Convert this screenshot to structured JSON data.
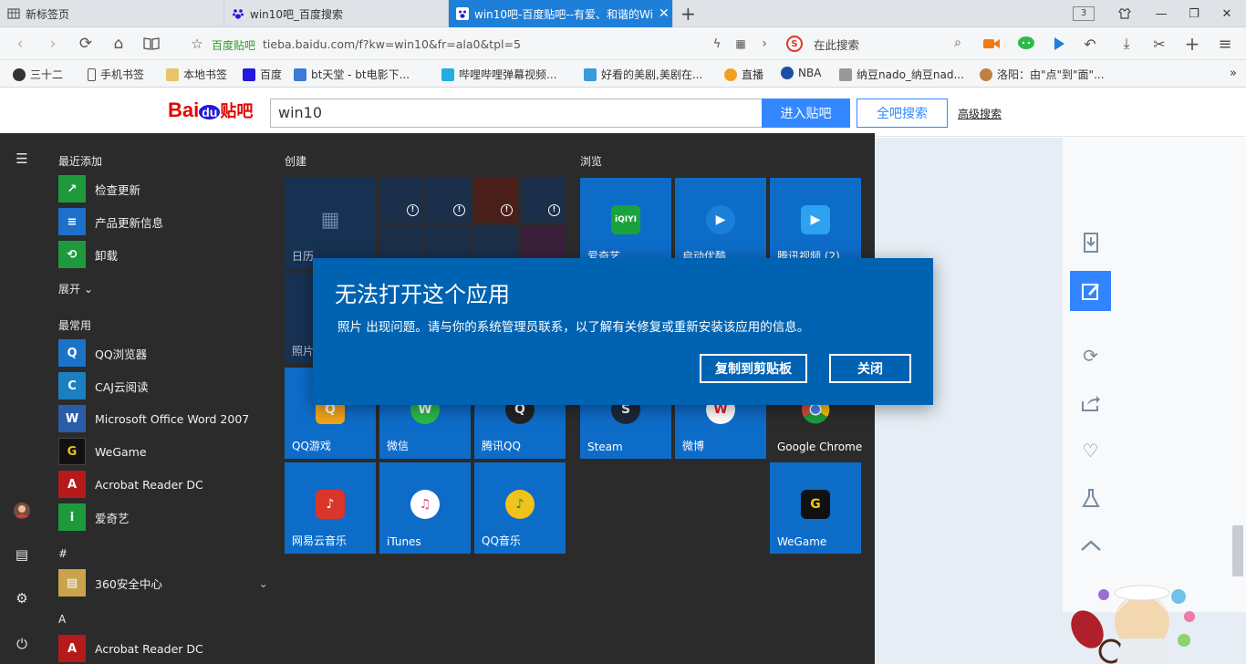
{
  "browser": {
    "tabs": [
      {
        "title": "新标签页",
        "active": false
      },
      {
        "title": "win10吧_百度搜索",
        "active": false
      },
      {
        "title": "win10吧-百度贴吧--有爱、和谐的Wi",
        "active": true
      }
    ],
    "tab_count": "3",
    "address": {
      "site_name": "百度贴吧",
      "url": "tieba.baidu.com/f?kw=win10&fr=ala0&tpl=5"
    },
    "search_placeholder": "在此搜索",
    "bookmarks": [
      "三十二",
      "手机书签",
      "本地书签",
      "百度",
      "bt天堂 - bt电影下...",
      "哔哩哔哩弹幕视频...",
      "好看的美剧,美剧在...",
      "直播",
      "NBA",
      "纳豆nado_纳豆nad...",
      "洛阳：由\"点\"到\"面\"..."
    ]
  },
  "tieba": {
    "logo_bai": "Bai",
    "logo_du": "du",
    "logo_tieba": "贴吧",
    "search_value": "win10",
    "enter_button": "进入贴吧",
    "all_search_button": "全吧搜索",
    "advanced_link": "高级搜索"
  },
  "start_menu": {
    "recent_header": "最近添加",
    "recent": [
      {
        "name": "检查更新",
        "color": "#1e9a3c",
        "glyph": "↗"
      },
      {
        "name": "产品更新信息",
        "color": "#1d6fc7",
        "glyph": "≡"
      },
      {
        "name": "卸载",
        "color": "#1e9a3c",
        "glyph": "⟲"
      }
    ],
    "expand_label": "展开",
    "frequent_header": "最常用",
    "frequent": [
      {
        "name": "QQ浏览器",
        "color": "#1a73c9",
        "glyph": "Q"
      },
      {
        "name": "CAJ云阅读",
        "color": "#1b7fc0",
        "glyph": "C"
      },
      {
        "name": "Microsoft Office Word 2007",
        "color": "#2b5ca8",
        "glyph": "W"
      },
      {
        "name": "WeGame",
        "color": "#111111",
        "glyph": "G"
      },
      {
        "name": "Acrobat Reader DC",
        "color": "#b51a1a",
        "glyph": "A"
      },
      {
        "name": "爱奇艺",
        "color": "#1e9a3c",
        "glyph": "i"
      }
    ],
    "hash_header": "#",
    "hash_apps": [
      {
        "name": "360安全中心",
        "color": "#c9a44a",
        "glyph": "▤"
      }
    ],
    "a_header": "A",
    "a_apps": [
      {
        "name": "Acrobat Reader DC",
        "color": "#b51a1a",
        "glyph": "A"
      }
    ],
    "create_title": "创建",
    "browse_title": "浏览",
    "create_tiles": [
      {
        "label": "日历"
      },
      {
        "label": "照片"
      },
      {
        "label": "QQ游戏",
        "glyph": "Q",
        "color": "#f2a51a"
      },
      {
        "label": "微信",
        "glyph": "W",
        "color": "#2bbb48"
      },
      {
        "label": "腾讯QQ",
        "glyph": "Q",
        "color": "#222222"
      },
      {
        "label": "网易云音乐",
        "glyph": "♪",
        "color": "#d9352b"
      },
      {
        "label": "iTunes",
        "glyph": "♫",
        "color": "#e0457a"
      },
      {
        "label": "QQ音乐",
        "glyph": "♪",
        "color": "#f0c21a"
      }
    ],
    "browse_tiles": [
      {
        "label": "爱奇艺",
        "glyph": "iQIYI",
        "color": "#1aa33c"
      },
      {
        "label": "启动优酷",
        "glyph": "▶",
        "color": "#1a7fd8"
      },
      {
        "label": "腾讯视频 (2)",
        "glyph": "▶",
        "color": "#2da3f0"
      },
      {
        "label": "Steam",
        "glyph": "S",
        "color": "#1b2838"
      },
      {
        "label": "微博",
        "glyph": "W",
        "color": "#e6162d"
      },
      {
        "label": "Google Chrome",
        "glyph": "◉",
        "color": "#dd4b39"
      },
      {
        "label": "WeGame",
        "glyph": "G",
        "color": "#111111"
      }
    ]
  },
  "dialog": {
    "title": "无法打开这个应用",
    "message": "照片 出现问题。请与你的系统管理员联系，以了解有关修复或重新安装该应用的信息。",
    "copy_button": "复制到剪贴板",
    "close_button": "关闭"
  },
  "colors": {
    "accent": "#0063b1",
    "tile_blue": "#0e6cc9",
    "start_bg": "#2b2b2b",
    "tieba_blue": "#3388ff",
    "baidu_red": "#e10602"
  }
}
